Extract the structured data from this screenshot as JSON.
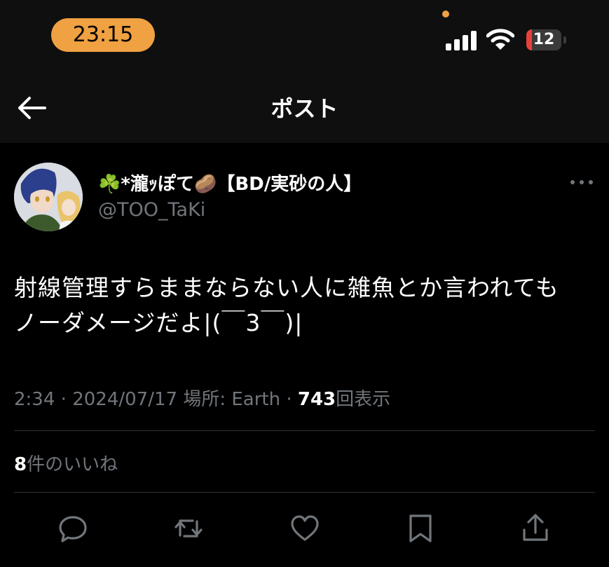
{
  "status_bar": {
    "time": "23:15",
    "battery_level": "12",
    "icons": [
      "signal-icon",
      "wifi-icon",
      "battery-icon"
    ],
    "accent_color": "#f0a142",
    "battery_color": "#e8403b"
  },
  "header": {
    "title": "ポスト",
    "back_icon": "arrow-left-icon"
  },
  "author": {
    "name_prefix": "☘️",
    "name_middle": "*瀧ｯぽて",
    "name_emoji": "🥔",
    "name_suffix": "【BD/実砂の人】",
    "handle": "@TOO_TaKi"
  },
  "tweet": {
    "lines": [
      "射線管理すらままならない人に雑魚とか言われても",
      "ノーダメージだよ|(￣3￣)|"
    ]
  },
  "meta": {
    "time": "2:34",
    "sep1": "·",
    "date": "2024/07/17",
    "location_label": "場所: Earth",
    "sep2": "·",
    "views_count": "743",
    "views_label": "回表示"
  },
  "likes": {
    "count": "8",
    "label": "件のいいね"
  },
  "actions": [
    "reply-icon",
    "repost-icon",
    "like-icon",
    "bookmark-icon",
    "share-icon"
  ]
}
